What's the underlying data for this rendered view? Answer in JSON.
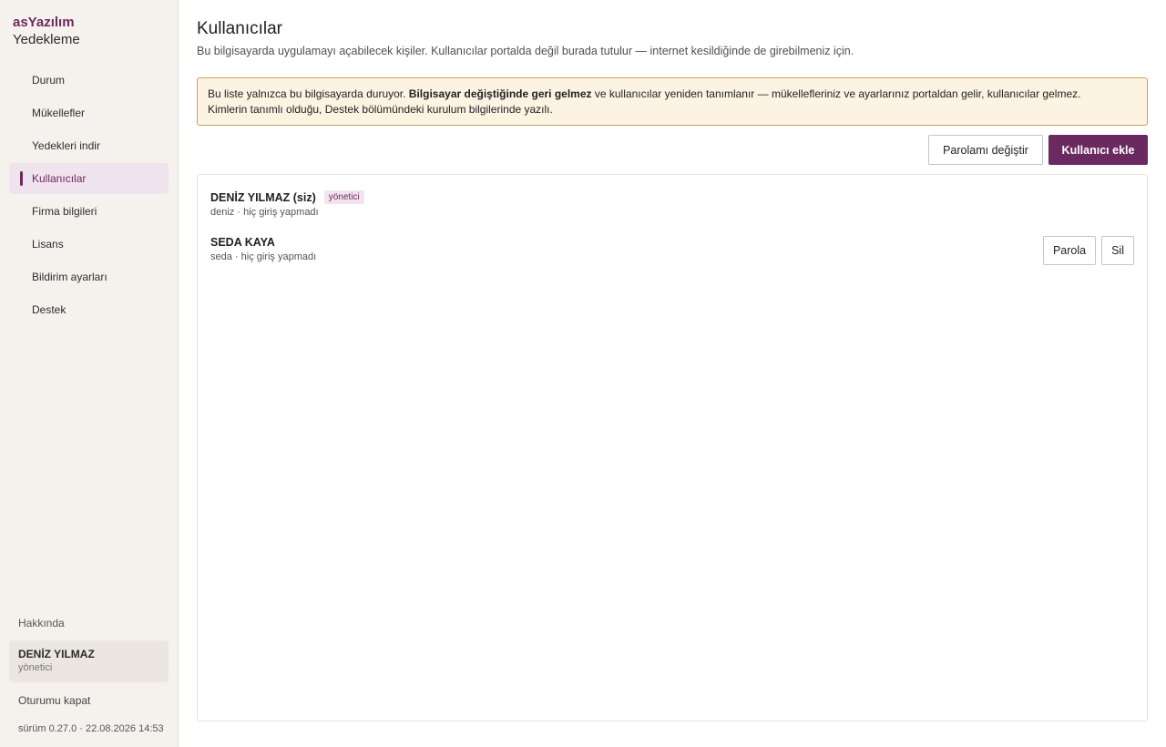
{
  "app": {
    "brand": "asYazılım",
    "title": "Yedekleme"
  },
  "sidebar": {
    "items": [
      {
        "label": "Durum",
        "active": false
      },
      {
        "label": "Mükellefler",
        "active": false
      },
      {
        "label": "Yedekleri indir",
        "active": false
      },
      {
        "label": "Kullanıcılar",
        "active": true
      },
      {
        "label": "Firma bilgileri",
        "active": false
      },
      {
        "label": "Lisans",
        "active": false
      },
      {
        "label": "Bildirim ayarları",
        "active": false
      },
      {
        "label": "Destek",
        "active": false
      }
    ],
    "about": "Hakkında",
    "user": {
      "name": "DENİZ YILMAZ",
      "role": "yönetici"
    },
    "logout": "Oturumu kapat",
    "version": "sürüm 0.27.0 · 22.08.2026 14:53"
  },
  "main": {
    "title": "Kullanıcılar",
    "subtitle": "Bu bilgisayarda uygulamayı açabilecek kişiler. Kullanıcılar portalda değil burada tutulur — internet kesildiğinde de girebilmeniz için.",
    "notice": {
      "part1": "Bu liste yalnızca bu bilgisayarda duruyor.",
      "bold": "Bilgisayar değiştiğinde geri gelmez",
      "part2": "ve kullanıcılar yeniden tanımlanır — mükellefleriniz ve ayarlarınız portaldan gelir, kullanıcılar gelmez.",
      "line2": "Kimlerin tanımlı olduğu, Destek bölümündeki kurulum bilgilerinde yazılı."
    },
    "buttons": {
      "change_password": "Parolamı değiştir",
      "add_user": "Kullanıcı ekle"
    },
    "users": [
      {
        "name": "DENİZ YILMAZ (siz)",
        "badge": "yönetici",
        "meta": "deniz · hiç giriş yapmadı"
      },
      {
        "name": "SEDA KAYA",
        "meta": "seda · hiç giriş yapmadı",
        "actions": {
          "password": "Parola",
          "delete": "Sil"
        }
      }
    ]
  },
  "colors": {
    "accent": "#6b2a5f",
    "notice_bg": "#fdf3e3",
    "notice_border": "#c9a15b",
    "sidebar_bg": "#f5f2ee"
  }
}
